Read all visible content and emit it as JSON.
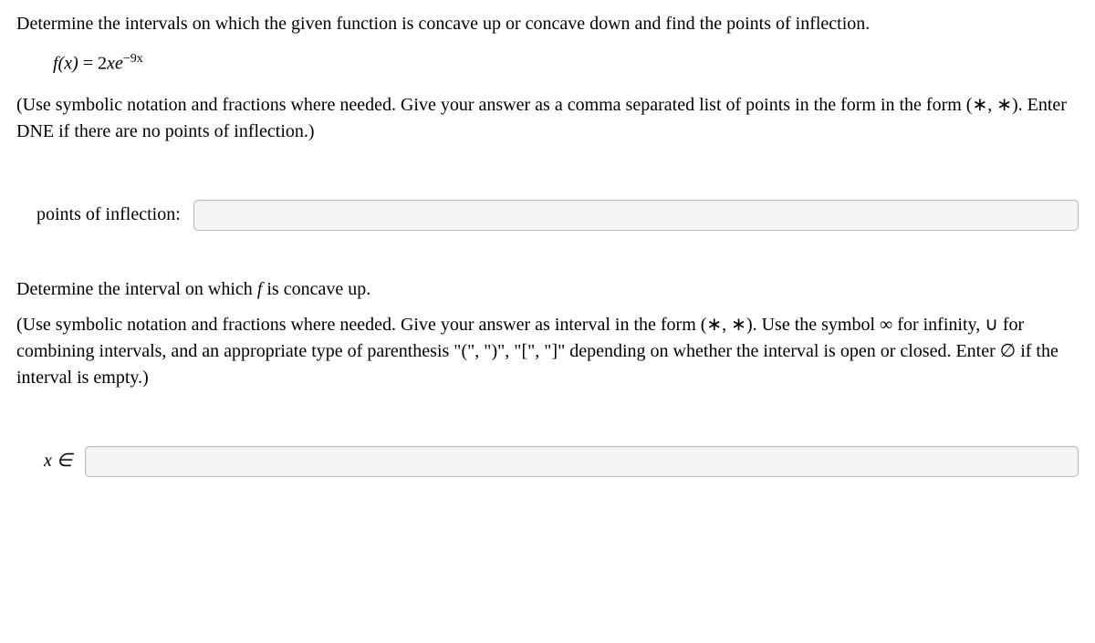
{
  "problem": {
    "intro": "Determine the intervals on which the given function is concave up or concave down and find the points of inflection.",
    "function_lhs": "f(x)",
    "eq": " = ",
    "coef": "2",
    "var": "x",
    "ebase": "e",
    "exponent": "−9x",
    "instruction1": "(Use symbolic notation and fractions where needed. Give your answer as a comma separated list of points in the form in the form (∗, ∗). Enter DNE if there are no points of inflection.)"
  },
  "part1": {
    "label": "points of inflection:",
    "value": ""
  },
  "part2": {
    "prompt_pre": "Determine the interval on which ",
    "prompt_f": "f",
    "prompt_post": " is concave up.",
    "instruction": "(Use symbolic notation and fractions where needed. Give your answer as interval in the form (∗, ∗). Use the symbol ∞ for infinity, ∪ for combining intervals, and an appropriate type of parenthesis \"(\", \")\", \"[\", \"]\" depending on whether the interval is open or closed. Enter ∅ if the interval is empty.)",
    "label": "x ∈",
    "value": ""
  }
}
